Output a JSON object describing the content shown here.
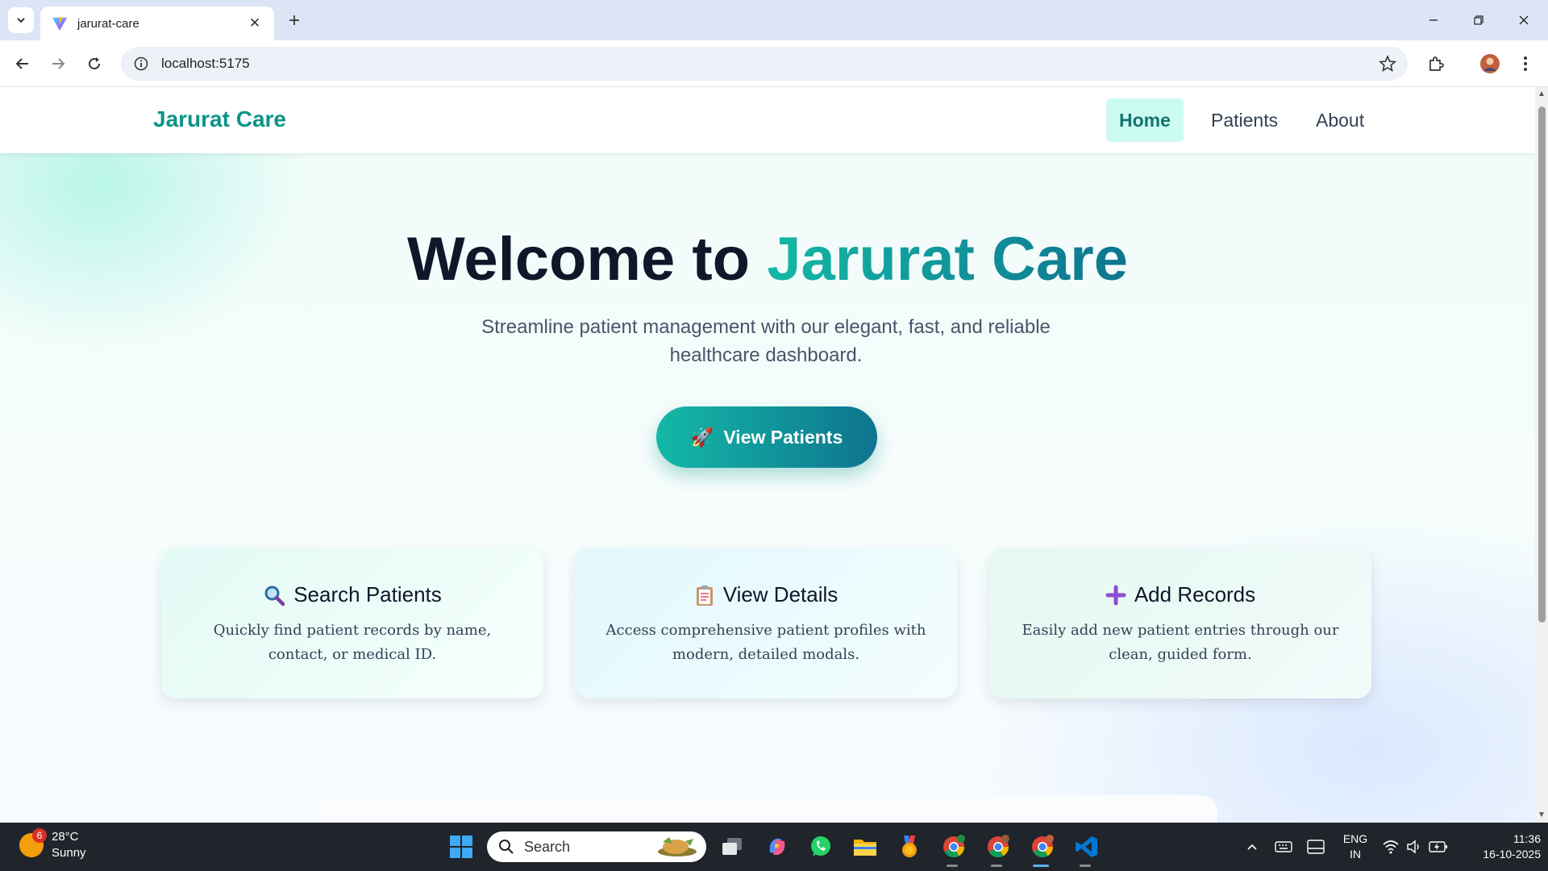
{
  "browser": {
    "tab_title": "jarurat-care",
    "url": "localhost:5175",
    "close_glyph": "✕",
    "new_tab_glyph": "+"
  },
  "navbar": {
    "brand": "Jarurat Care",
    "links": [
      {
        "label": "Home",
        "active": true
      },
      {
        "label": "Patients",
        "active": false
      },
      {
        "label": "About",
        "active": false
      }
    ]
  },
  "hero": {
    "title_prefix": "Welcome to ",
    "title_accent": "Jarurat Care",
    "subtitle": "Streamline patient management with our elegant, fast, and reliable healthcare dashboard.",
    "cta_label": "View Patients",
    "cta_icon": "🚀"
  },
  "features": [
    {
      "icon": "magnifier-icon",
      "title": "Search Patients",
      "description": "Quickly find patient records by name, contact, or medical ID."
    },
    {
      "icon": "clipboard-icon",
      "title": "View Details",
      "description": "Access comprehensive patient profiles with modern, detailed modals."
    },
    {
      "icon": "plus-icon",
      "title": "Add Records",
      "description": "Easily add new patient entries through our clean, guided form."
    }
  ],
  "taskbar": {
    "weather_badge": "6",
    "temperature": "28°C",
    "condition": "Sunny",
    "search_placeholder": "Search",
    "lang_top": "ENG",
    "lang_bottom": "IN",
    "time": "11:36",
    "date": "16-10-2025"
  },
  "colors": {
    "brand": "#0d9488",
    "accent_start": "#14b8a6",
    "accent_end": "#0e7490",
    "active_nav_bg": "#ccfbf1"
  }
}
